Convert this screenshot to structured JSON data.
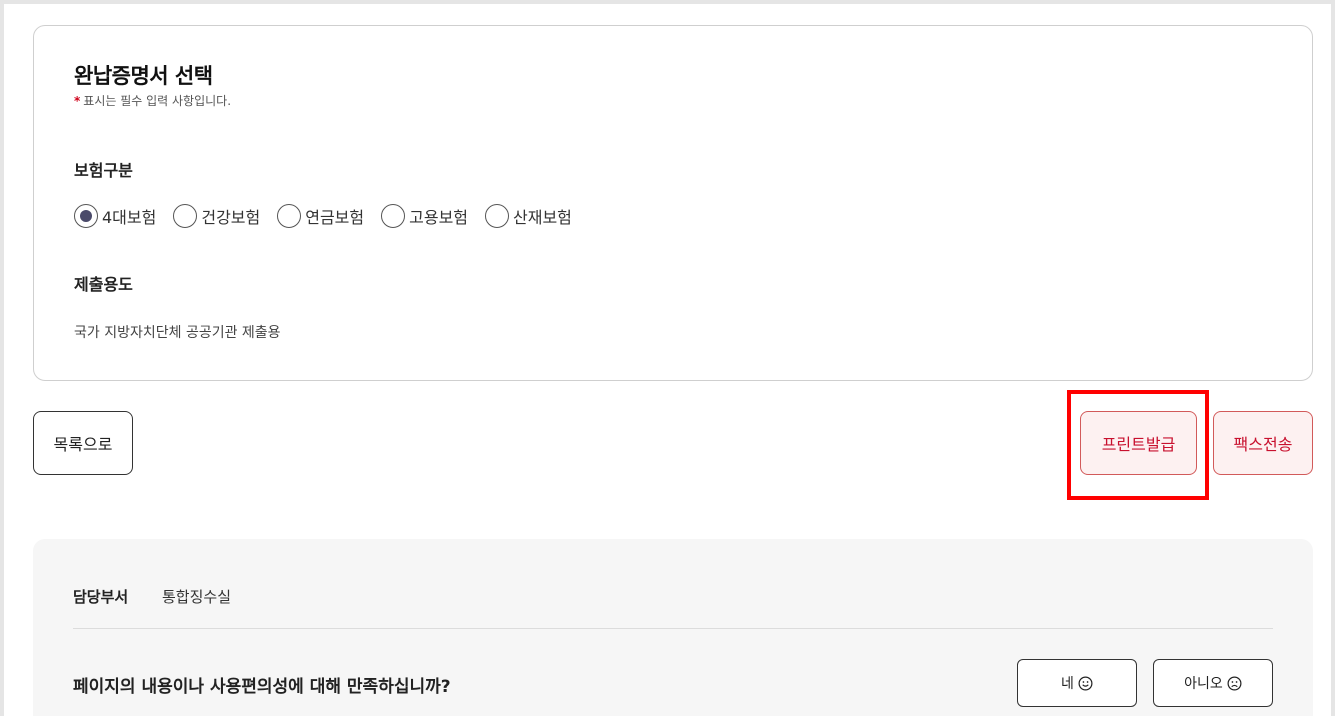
{
  "card": {
    "title": "완납증명서 선택",
    "required_star": "*",
    "required_note": "표시는 필수 입력 사항입니다.",
    "insurance_label": "보험구분",
    "insurance_options": [
      {
        "label": "4대보험",
        "checked": true
      },
      {
        "label": "건강보험",
        "checked": false
      },
      {
        "label": "연금보험",
        "checked": false
      },
      {
        "label": "고용보험",
        "checked": false
      },
      {
        "label": "산재보험",
        "checked": false
      }
    ],
    "purpose_label": "제출용도",
    "purpose_value": "국가 지방자치단체 공공기관 제출용"
  },
  "actions": {
    "list_label": "목록으로",
    "print_label": "프린트발급",
    "fax_label": "팩스전송"
  },
  "footer": {
    "dept_label": "담당부서",
    "dept_value": "통합징수실",
    "survey_question": "페이지의 내용이나 사용편의성에 대해 만족하십니까?",
    "yes_label": "네",
    "no_label": "아니오"
  },
  "colors": {
    "accent_red": "#c8102e",
    "highlight": "#ff0000"
  }
}
